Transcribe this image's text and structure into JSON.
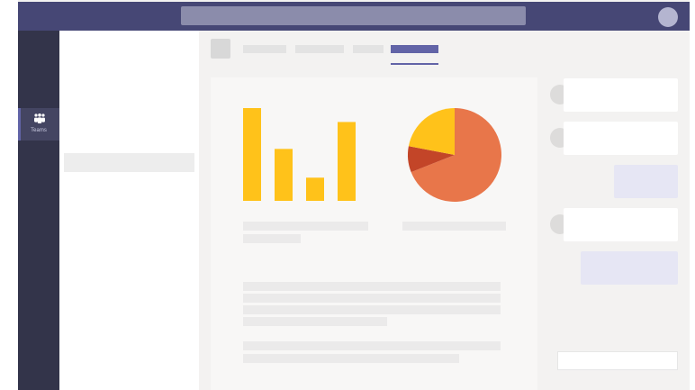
{
  "app": {
    "colors": {
      "brand": "#464775",
      "accent": "#6264a7",
      "rail": "#33344a",
      "bar": "#ffc21a",
      "pie_main": "#e8764a",
      "pie_yellow": "#ffc21a",
      "pie_red": "#c34528"
    }
  },
  "rail": {
    "items": [
      {
        "label": "Teams",
        "icon": "teams-icon",
        "selected": true
      }
    ]
  },
  "chart_data": [
    {
      "type": "bar",
      "categories": [
        "",
        "",
        "",
        ""
      ],
      "values": [
        100,
        56,
        25,
        85
      ],
      "title": "",
      "xlabel": "",
      "ylabel": "",
      "ylim": [
        0,
        100
      ]
    },
    {
      "type": "pie",
      "labels": [
        "",
        "",
        ""
      ],
      "values": [
        69,
        9,
        22
      ],
      "colors": [
        "#e8764a",
        "#c34528",
        "#ffc21a"
      ]
    }
  ]
}
